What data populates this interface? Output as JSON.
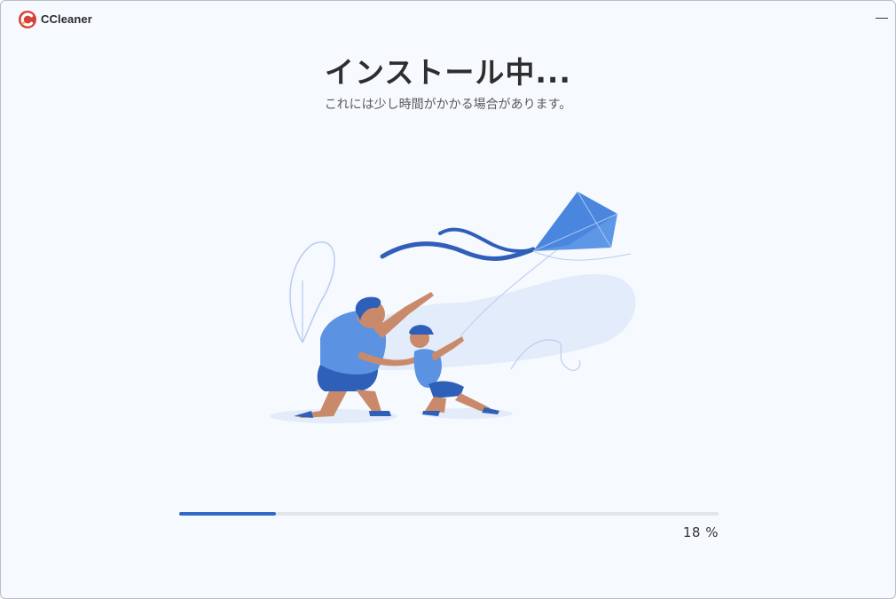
{
  "app": {
    "name": "CCleaner"
  },
  "installer": {
    "title": "インストール中...",
    "subtitle": "これには少し時間がかかる場合があります。"
  },
  "progress": {
    "percent": 18,
    "label": "18 %"
  },
  "icons": {
    "logo": "ccleaner-logo-icon",
    "minimize": "minimize-icon",
    "illustration": "kite-flying-illustration"
  },
  "colors": {
    "accent": "#2f6bc6",
    "track": "#e2e5ea",
    "background": "#f6f9fe"
  }
}
